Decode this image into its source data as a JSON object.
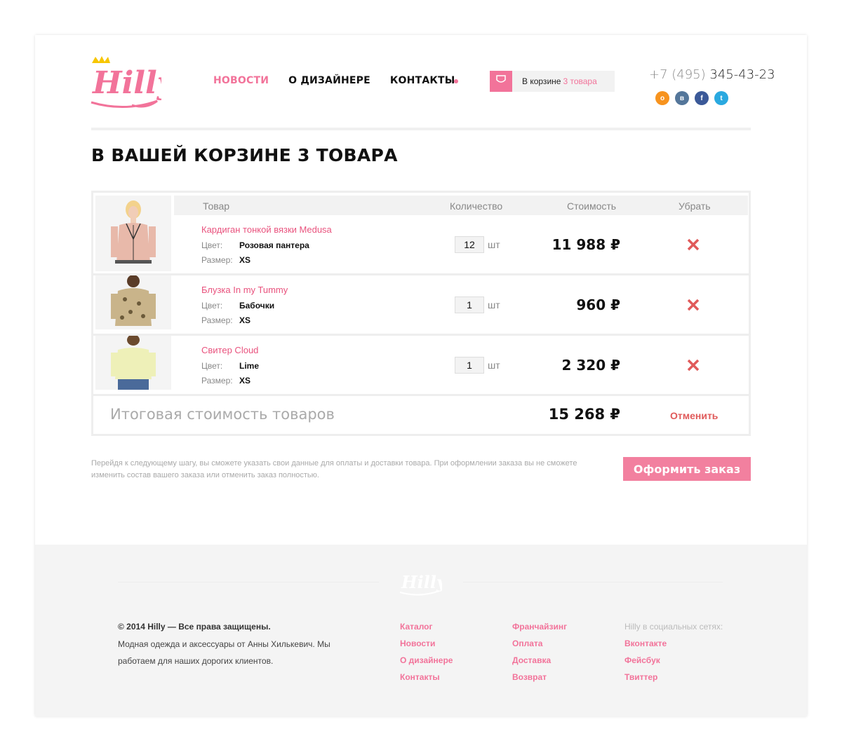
{
  "header": {
    "logo_text": "Hilly",
    "nav": [
      {
        "label": "НОВОСТИ",
        "active": true
      },
      {
        "label": "О ДИЗАЙНЕРЕ",
        "active": false
      },
      {
        "label": "КОНТАКТЫ",
        "active": false
      }
    ],
    "cart": {
      "label": "В корзине",
      "count": "3 товара"
    },
    "phone": {
      "code": "+7 (495)",
      "number": "345-43-23"
    },
    "socials": [
      {
        "name": "odnoklassniki-icon",
        "glyph": "о",
        "color": "#f7931e"
      },
      {
        "name": "vkontakte-icon",
        "glyph": "в",
        "color": "#54769a"
      },
      {
        "name": "facebook-icon",
        "glyph": "f",
        "color": "#3b5998"
      },
      {
        "name": "twitter-icon",
        "glyph": "t",
        "color": "#2aa9e0"
      }
    ]
  },
  "page_title": "В ВАШЕЙ КОРЗИНЕ 3 ТОВАРА",
  "table": {
    "headers": {
      "product": "Товар",
      "quantity": "Количество",
      "cost": "Стоимость",
      "remove": "Убрать"
    },
    "color_label": "Цвет:",
    "size_label": "Размер:",
    "unit": "шт",
    "items": [
      {
        "name": "Кардиган тонкой вязки Medusa",
        "color": "Розовая пантера",
        "size": "XS",
        "qty": "12",
        "price": "11 988 ₽"
      },
      {
        "name": "Блузка In my Tummy",
        "color": "Бабочки",
        "size": "XS",
        "qty": "1",
        "price": "960 ₽"
      },
      {
        "name": "Свитер Cloud",
        "color": "Lime",
        "size": "XS",
        "qty": "1",
        "price": "2 320 ₽"
      }
    ],
    "total_label": "Итоговая стоимость товаров",
    "total_price": "15 268 ₽",
    "cancel_label": "Отменить"
  },
  "note": "Перейдя к следующему шагу, вы сможете указать свои данные для оплаты и доставки товара. При оформлении заказа вы не сможете изменить состав вашего заказа или отменить заказ полностью.",
  "order_button": "Оформить заказ",
  "footer": {
    "copyright": "© 2014 Hilly — Все права защищены.",
    "description": "Модная одежда и аксессуары от Анны Хилькевич. Мы работаем для наших дорогих клиентов.",
    "col1": [
      "Каталог",
      "Новости",
      "О дизайнере",
      "Контакты"
    ],
    "col2": [
      "Франчайзинг",
      "Оплата",
      "Доставка",
      "Возврат"
    ],
    "social_heading": "Hilly в социальных сетях:",
    "col3": [
      "Вконтакте",
      "Фейсбук",
      "Твиттер"
    ]
  },
  "colors": {
    "accent": "#f2739a",
    "remove": "#e05a5a",
    "button": "#f2809f"
  }
}
